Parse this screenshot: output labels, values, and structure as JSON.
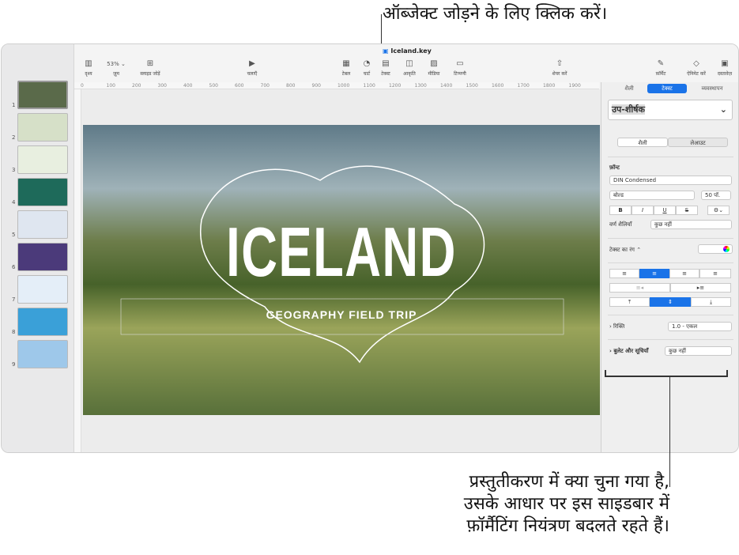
{
  "callouts": {
    "top": "ऑब्जेक्ट जोड़ने के लिए क्लिक करें।",
    "bottom_1": "प्रस्तुतीकरण में क्या चुना गया है,",
    "bottom_2": "उसके आधार पर इस साइडबार में",
    "bottom_3": "फ़ॉर्मैटिंग नियंत्रण बदलते रहते हैं।"
  },
  "window": {
    "title": "Iceland.key"
  },
  "toolbar": {
    "view": "दृश्य",
    "zoom_value": "53% ⌄",
    "zoom": "ज़ूम",
    "add_slide": "स्लाइड जोड़ें",
    "play": "चलाएँ",
    "table": "टेबल",
    "chart": "चार्ट",
    "text": "टेक्स्ट",
    "shape": "आकृति",
    "media": "मीडिया",
    "comment": "टिप्पणी",
    "share": "शेयर करें",
    "format": "फ़ॉर्मैट",
    "animate": "ऐनिमेट करें",
    "document": "दस्तावेज़"
  },
  "ruler": [
    "0",
    "100",
    "200",
    "300",
    "400",
    "500",
    "600",
    "700",
    "800",
    "900",
    "1000",
    "1100",
    "1200",
    "1300",
    "1400",
    "1500",
    "1600",
    "1700",
    "1800",
    "1900"
  ],
  "slides": [
    "1",
    "2",
    "3",
    "4",
    "5",
    "6",
    "7",
    "8",
    "9"
  ],
  "slide": {
    "title": "ICELAND",
    "subtitle": "GEOGRAPHY FIELD TRIP"
  },
  "inspector": {
    "tabs": [
      "शैली",
      "टेक्स्ट",
      "व्यवस्थापन"
    ],
    "style_name": "उप-शीर्षक",
    "sub_tabs": [
      "शैली",
      "लेआउट"
    ],
    "font_label": "फ़ॉन्ट",
    "font_name": "DIN Condensed",
    "font_weight": "बोल्ड",
    "font_size": "50 पॉ.",
    "bold": "B",
    "italic": "I",
    "underline": "U",
    "strike": "S",
    "char_styles_label": "वर्ण शैलियाँ",
    "char_styles_value": "कुछ नहीं",
    "text_color_label": "टेक्स्ट का रंग ⌃",
    "spacing_label": "रिक्ति",
    "spacing_value": "1.0 - एकल",
    "bullets_label": "बुलेट और सूचियाँ",
    "bullets_value": "कुछ नहीं"
  },
  "colors": {
    "accent": "#1a73e8"
  }
}
